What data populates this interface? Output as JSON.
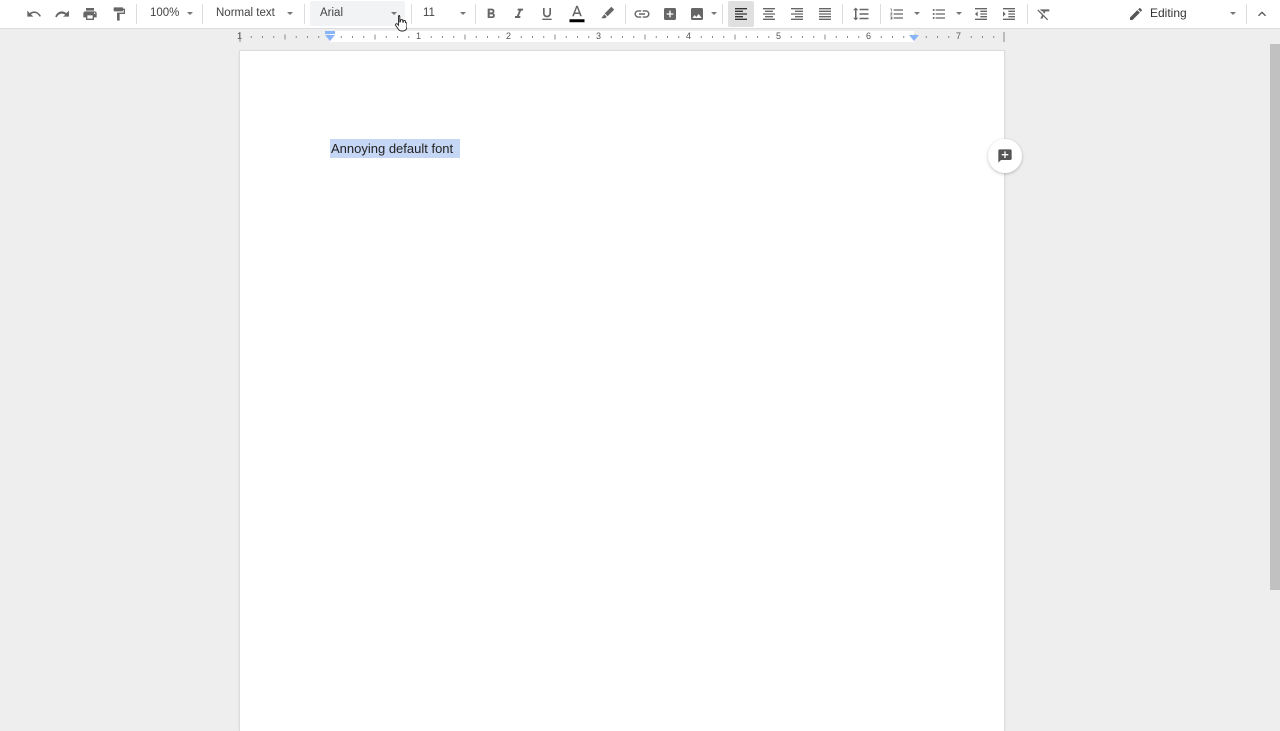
{
  "toolbar": {
    "zoom": "100%",
    "style": "Normal text",
    "font": "Arial",
    "font_size": "11",
    "mode": "Editing"
  },
  "ruler": {
    "numbers": [
      "1",
      "1",
      "2",
      "3",
      "4",
      "5",
      "6",
      "7"
    ]
  },
  "document": {
    "text": "Annoying default font"
  },
  "colors": {
    "selection": "#c6d6f5",
    "text_color_bar": "#000000"
  }
}
